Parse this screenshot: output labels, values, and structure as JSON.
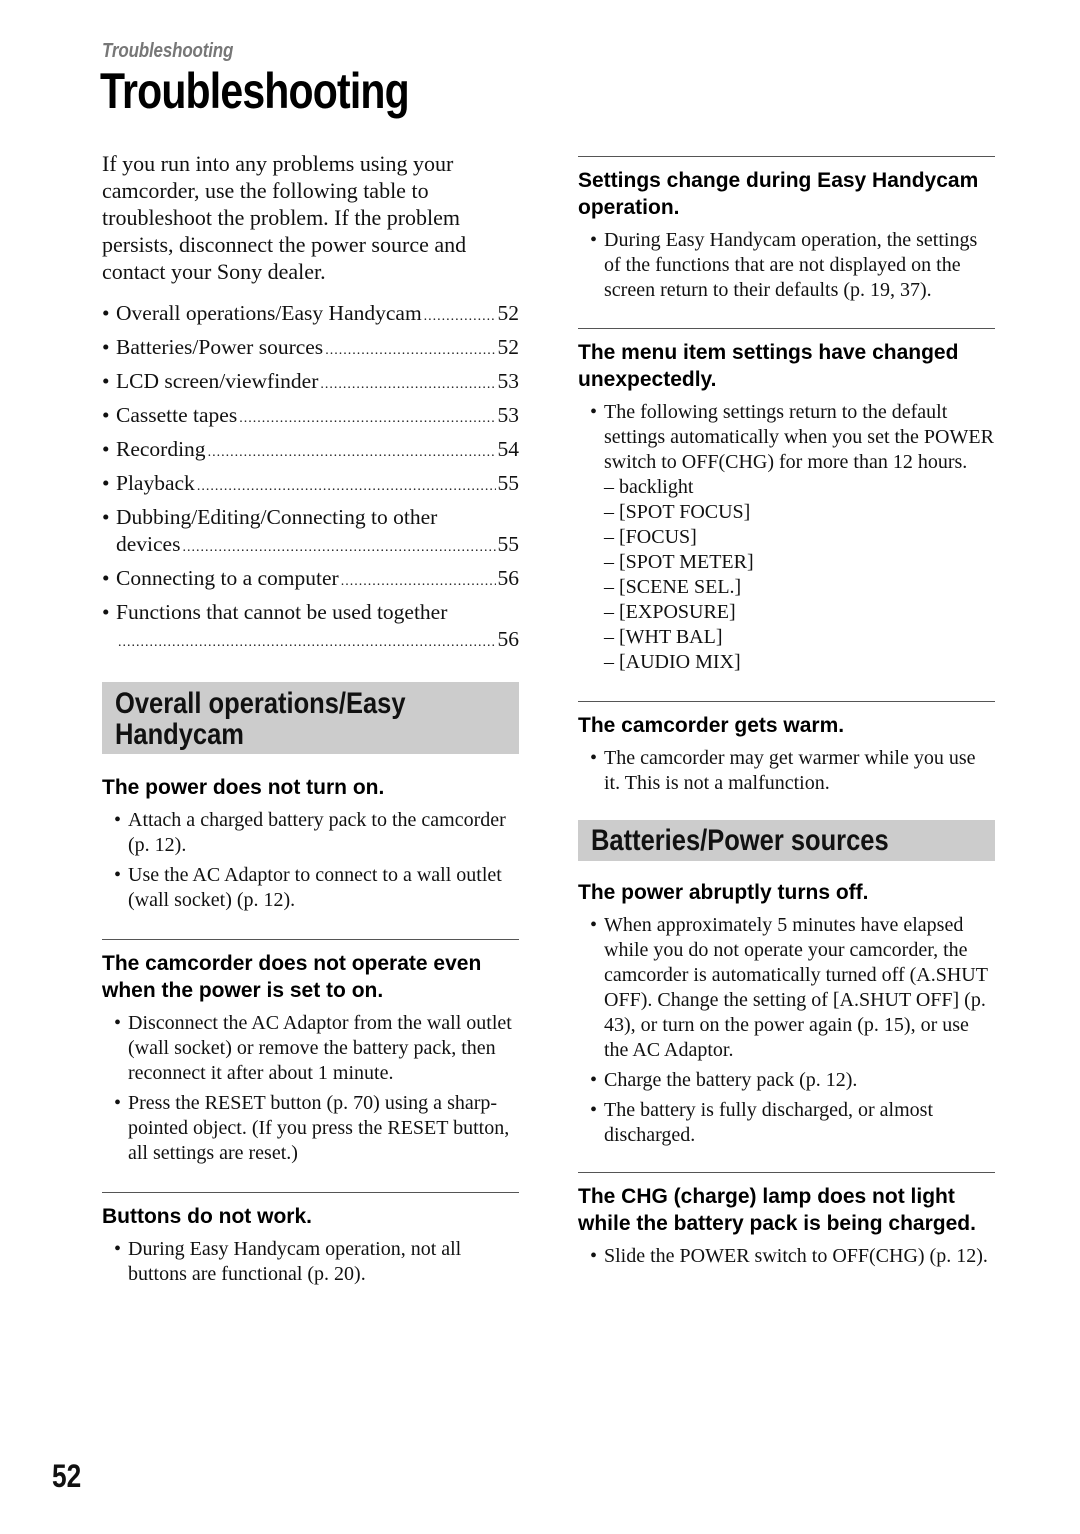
{
  "header": {
    "running_title": "Troubleshooting",
    "title": "Troubleshooting"
  },
  "intro": "If you run into any problems using your camcorder, use the following table to troubleshoot the problem. If the problem persists, disconnect the power source and contact your Sony dealer.",
  "toc": [
    {
      "label": "Overall operations/Easy Handycam",
      "page": "52"
    },
    {
      "label": "Batteries/Power sources",
      "page": "52"
    },
    {
      "label": "LCD screen/viewfinder",
      "page": "53"
    },
    {
      "label": "Cassette tapes",
      "page": "53"
    },
    {
      "label": "Recording",
      "page": "54"
    },
    {
      "label": "Playback",
      "page": "55"
    },
    {
      "label_line1": "Dubbing/Editing/Connecting to other",
      "label": "devices",
      "page": "55"
    },
    {
      "label": "Connecting to a computer",
      "page": "56"
    },
    {
      "label_line1": "Functions that cannot be used together",
      "label": "",
      "page": "56"
    }
  ],
  "sections": {
    "overall": {
      "heading_line1": "Overall operations/Easy",
      "heading_line2": "Handycam",
      "items": [
        {
          "question": "The power does not turn on.",
          "answers": [
            "Attach a charged battery pack to the camcorder (p. 12).",
            "Use the AC Adaptor to connect to a wall outlet (wall socket) (p. 12)."
          ]
        },
        {
          "question": "The camcorder does not operate even when the power is set to on.",
          "answers": [
            "Disconnect the AC Adaptor from the wall outlet (wall socket) or remove the battery pack, then reconnect it after about 1 minute.",
            "Press the RESET button (p. 70) using a sharp-pointed object. (If you press the RESET button, all settings are reset.)"
          ]
        },
        {
          "question": "Buttons do not work.",
          "answers": [
            "During Easy Handycam operation, not all buttons are functional (p. 20)."
          ]
        },
        {
          "question": "Settings change during Easy Handycam operation.",
          "answers": [
            "During Easy Handycam operation, the settings of the functions that are not displayed on the screen return to their defaults (p. 19, 37)."
          ]
        },
        {
          "question": "The menu item settings have changed unexpectedly.",
          "answers": [
            "The following settings return to the default settings automatically when you set the POWER switch to OFF(CHG) for more than 12 hours."
          ],
          "sub_items": [
            "– backlight",
            "– [SPOT FOCUS]",
            "– [FOCUS]",
            "– [SPOT METER]",
            "– [SCENE SEL.]",
            "– [EXPOSURE]",
            "– [WHT BAL]",
            "– [AUDIO MIX]"
          ]
        },
        {
          "question": "The camcorder gets warm.",
          "answers": [
            "The camcorder may get warmer while you use it. This is not a malfunction."
          ]
        }
      ]
    },
    "batteries": {
      "heading": "Batteries/Power sources",
      "items": [
        {
          "question": "The power abruptly turns off.",
          "answers": [
            "When approximately 5 minutes have elapsed while you do not operate your camcorder, the camcorder is automatically turned off (A.SHUT OFF). Change the setting of [A.SHUT OFF] (p. 43), or turn on the power again (p. 15), or use the AC Adaptor.",
            "Charge the battery pack (p. 12).",
            "The battery is fully discharged, or almost discharged."
          ]
        },
        {
          "question": "The CHG (charge) lamp does not light while the battery pack is being charged.",
          "answers": [
            "Slide the POWER switch to OFF(CHG) (p. 12)."
          ]
        }
      ]
    }
  },
  "footer": {
    "page_number": "52"
  }
}
